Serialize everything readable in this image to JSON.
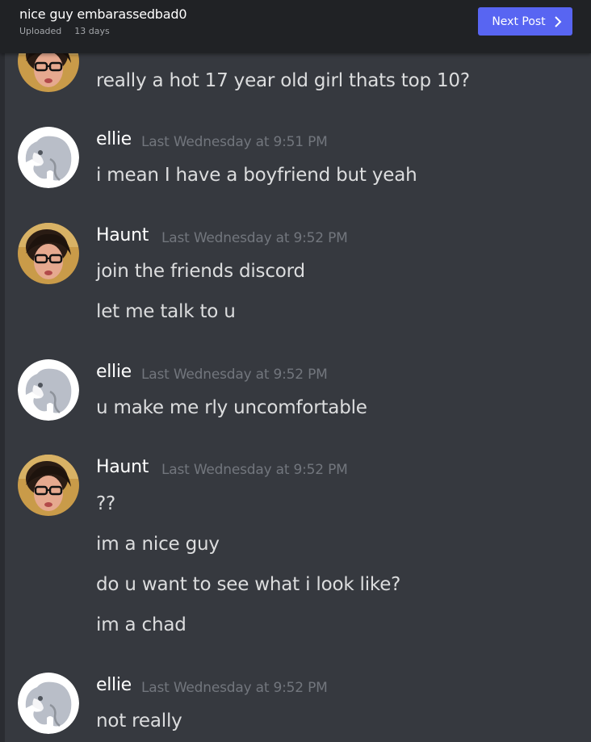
{
  "header": {
    "title": "nice guy embarassedbad0",
    "uploaded_label": "Uploaded",
    "uploaded_ago": "13 days",
    "next_button_label": "Next Post"
  },
  "messages": {
    "first": {
      "text": "really a hot 17 year old girl thats top 10?"
    },
    "g1": {
      "user": "ellie",
      "time": "Last Wednesday at 9:51 PM",
      "lines": [
        "i mean I have a boyfriend but yeah"
      ]
    },
    "g2": {
      "user": "Haunt",
      "time": "Last Wednesday at 9:52 PM",
      "lines": [
        "join the friends discord",
        "let me talk to u"
      ]
    },
    "g3": {
      "user": "ellie",
      "time": "Last Wednesday at 9:52 PM",
      "lines": [
        "u make me rly uncomfortable"
      ]
    },
    "g4": {
      "user": "Haunt",
      "time": "Last Wednesday at 9:52 PM",
      "lines": [
        "??",
        "im a nice guy",
        "do u want to see what i look like?",
        "im a chad"
      ]
    },
    "g5": {
      "user": "ellie",
      "time": "Last Wednesday at 9:52 PM",
      "lines": [
        "not really"
      ]
    }
  },
  "colors": {
    "background": "#36393f",
    "header_bg": "#202225",
    "accent": "#5865f2",
    "username": "#ffffff",
    "timestamp": "#72767d",
    "message_text": "#dcddde"
  },
  "icons": {
    "next": "chevron-right-icon",
    "ellie_avatar": "elephant-avatar-icon",
    "haunt_avatar": "user-photo-avatar"
  }
}
